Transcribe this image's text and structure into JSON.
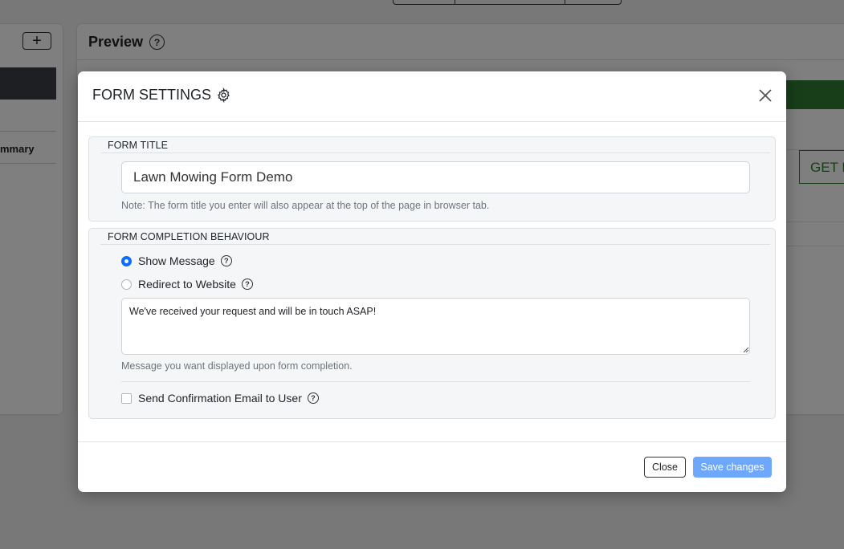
{
  "background": {
    "add_button": "+",
    "summary_label": "mmary",
    "preview_title": "Preview",
    "preview_help": "?",
    "get_button": "GET M"
  },
  "modal": {
    "title": "FORM SETTINGS",
    "title_icon": "gear-icon",
    "close_icon": "close-icon",
    "form_title_section": {
      "legend": "FORM TITLE",
      "input_value": "Lawn Mowing Form Demo",
      "note": "Note: The form title you enter will also appear at the top of the page in browser tab."
    },
    "completion_section": {
      "legend": "FORM COMPLETION BEHAVIOUR",
      "options": [
        {
          "label": "Show Message",
          "checked": true
        },
        {
          "label": "Redirect to Website",
          "checked": false
        }
      ],
      "help_glyph": "?",
      "message_value": "We've received your request and will be in touch ASAP!",
      "message_help": "Message you want displayed upon form completion.",
      "confirmation_label": "Send Confirmation Email to User",
      "confirmation_checked": false
    },
    "footer": {
      "close_label": "Close",
      "save_label": "Save changes"
    }
  },
  "colors": {
    "primary": "#0d6efd",
    "save_button": "#6ea8fe",
    "brand_green": "#2e7d32"
  }
}
